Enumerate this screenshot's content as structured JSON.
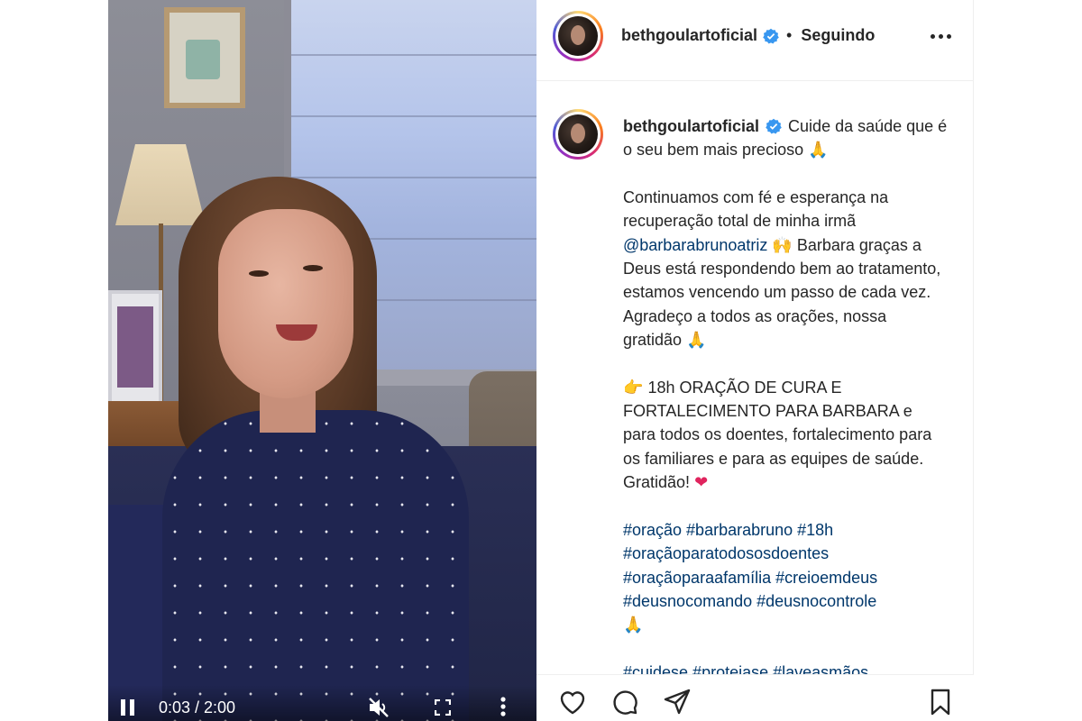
{
  "post": {
    "username": "bethgoulartoficial",
    "follow_dot": "•",
    "follow_status": "Seguindo",
    "verified": true
  },
  "video": {
    "time": "0:03 / 2:00",
    "state": "paused-icon-shown",
    "muted": true
  },
  "caption": {
    "username": "bethgoulartoficial",
    "line1": "Cuide da saúde que é o seu bem mais precioso",
    "emoji_pray": "🙏",
    "para2_a": "Continuamos com fé e esperança na recuperação total de minha irmã",
    "mention": "@barbarabrunoatriz",
    "emoji_hands": "🙌",
    "para2_b": "Barbara graças a Deus está respondendo bem ao tratamento, estamos vencendo um passo de cada vez. Agradeço a todos as orações, nossa gratidão",
    "emoji_point": "👉",
    "para3": "18h ORAÇÃO DE CURA E FORTALECIMENTO PARA BARBARA e para todos os doentes, fortalecimento para os familiares e para as equipes de saúde. Gratidão!",
    "emoji_heart": "❤",
    "hashtags_1": "#oração #barbarabruno #18h",
    "hashtags_2": "#oraçãoparatodososdoentes",
    "hashtags_3": "#oraçãoparaafamília #creioemdeus",
    "hashtags_4": "#deusnocomando #deusnocontrole",
    "hashtags_5": "#cuidese #protejase #laveasmãos"
  },
  "icons": {
    "like": "heart-icon",
    "comment": "comment-icon",
    "share": "send-icon",
    "save": "bookmark-icon"
  },
  "colors": {
    "link": "#00376b",
    "verified": "#3897f0",
    "text": "#262626"
  }
}
